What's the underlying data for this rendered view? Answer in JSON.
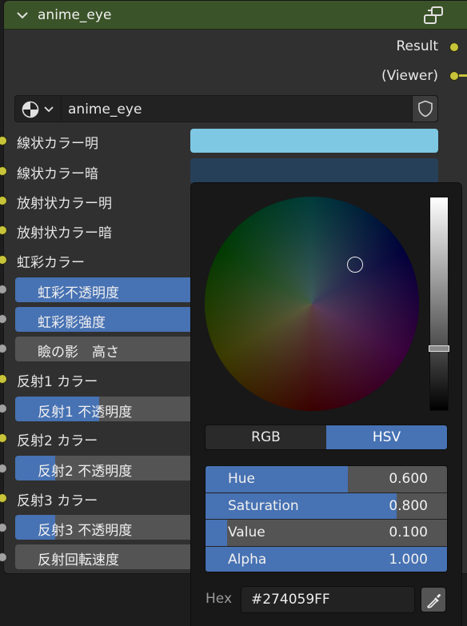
{
  "node": {
    "title": "anime_eye",
    "outputs": [
      "Result",
      "(Viewer)"
    ],
    "material_name": "anime_eye",
    "header_color": "#3b5328",
    "socket_color": "#c8c43a"
  },
  "inputs": {
    "color_linear_light": "線状カラー明",
    "color_linear_dark": "線状カラー暗",
    "color_radial_light": "放射状カラー明",
    "color_radial_dark": "放射状カラー暗",
    "color_iris": "虹彩カラー",
    "reflect1_color": "反射1 カラー",
    "reflect2_color": "反射2 カラー",
    "reflect3_color": "反射3 カラー"
  },
  "swatches": {
    "linear_light": "#7ec8e3",
    "linear_dark": "#274059"
  },
  "sliders": [
    {
      "label": "虹彩不透明度",
      "fill": 1.0
    },
    {
      "label": "虹彩影強度",
      "fill": 1.0
    },
    {
      "label": "瞼の影　高さ",
      "fill": 0.0
    },
    {
      "label": "反射1 不透明度",
      "fill": 0.42
    },
    {
      "label": "反射2 不透明度",
      "fill": 0.2
    },
    {
      "label": "反射3 不透明度",
      "fill": 0.2
    },
    {
      "label": "反射回転速度",
      "fill": 0.0
    }
  ],
  "color_picker": {
    "modes": [
      "RGB",
      "HSV"
    ],
    "active_mode": "HSV",
    "props": [
      {
        "label": "Hue",
        "value": "0.600",
        "fill": 0.6
      },
      {
        "label": "Saturation",
        "value": "0.800",
        "fill": 0.8
      },
      {
        "label": "Value",
        "value": "0.100",
        "fill": 0.1
      },
      {
        "label": "Alpha",
        "value": "1.000",
        "fill": 1.0
      }
    ],
    "hex_label": "Hex",
    "hex_value": "#274059FF",
    "value_level": 0.1
  }
}
